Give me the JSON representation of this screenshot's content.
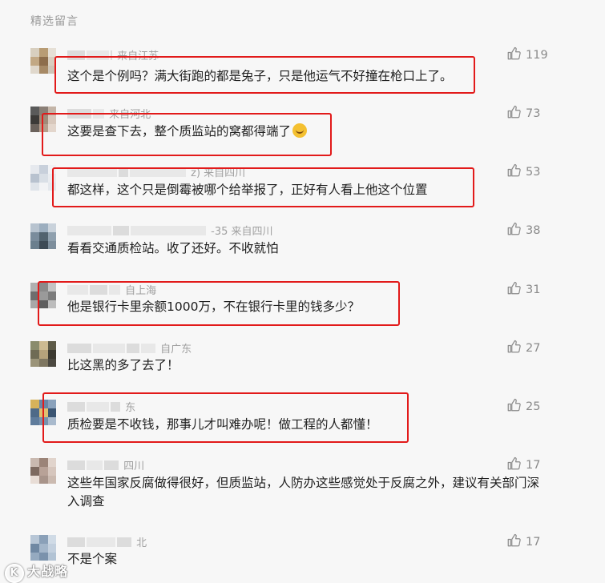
{
  "section_title": "精选留言",
  "colors": {
    "highlight": "#e21a1a",
    "meta": "#a0a0a0",
    "like": "#8a8a8a"
  },
  "comments": [
    {
      "source": "来自江苏",
      "text": "这个是个例吗？满大街跑的都是兔子，只是他运气不好撞在枪口上了。",
      "likes": "119",
      "highlighted": true
    },
    {
      "source": "来自河北",
      "text": "这要是查下去，整个质监站的窝都得端了",
      "emoji": "laughing-tears",
      "likes": "73",
      "highlighted": true
    },
    {
      "source": "z) 来自四川",
      "text": "都这样，这个只是倒霉被哪个给举报了，正好有人看上他这个位置",
      "likes": "53",
      "highlighted": true
    },
    {
      "source": "-35 来自四川",
      "text": "看看交通质检站。收了还好。不收就怕",
      "likes": "38",
      "highlighted": false
    },
    {
      "source": "自上海",
      "text": "他是银行卡里余额1000万，不在银行卡里的钱多少？",
      "likes": "31",
      "highlighted": true
    },
    {
      "source": "自广东",
      "text": "比这黑的多了去了！",
      "likes": "27",
      "highlighted": false
    },
    {
      "source": "东",
      "text": "质检要是不收钱，那事儿才叫难办呢！做工程的人都懂！",
      "likes": "25",
      "highlighted": true
    },
    {
      "source": "四川",
      "text": "这些年国家反腐做得很好，但质监站，人防办这些感觉处于反腐之外，建议有关部门深入调查",
      "likes": "17",
      "highlighted": false
    },
    {
      "source": "北",
      "text": "不是个案",
      "likes": "17",
      "highlighted": false
    }
  ],
  "watermark": {
    "logo_text": "K",
    "text": "大战略"
  }
}
